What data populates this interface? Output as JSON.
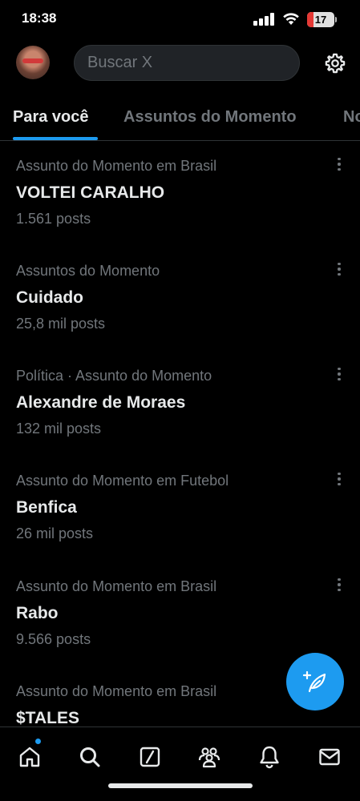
{
  "status_bar": {
    "time": "18:38",
    "battery": "17"
  },
  "header": {
    "search_placeholder": "Buscar X"
  },
  "tabs": [
    {
      "label": "Para você",
      "active": true
    },
    {
      "label": "Assuntos do Momento",
      "active": false
    },
    {
      "label": "No",
      "active": false
    }
  ],
  "trends": [
    {
      "context": "Assunto do Momento em Brasil",
      "name": "VOLTEI CARALHO",
      "count": "1.561 posts"
    },
    {
      "context": "Assuntos do Momento",
      "name": "Cuidado",
      "count": "25,8 mil posts"
    },
    {
      "context": "Política · Assunto do Momento",
      "name": "Alexandre de Moraes",
      "count": "132 mil posts"
    },
    {
      "context": "Assunto do Momento em Futebol",
      "name": "Benfica",
      "count": "26 mil posts"
    },
    {
      "context": "Assunto do Momento em Brasil",
      "name": "Rabo",
      "count": "9.566 posts"
    },
    {
      "context": "Assunto do Momento em Brasil",
      "name": "$TALES",
      "count": ""
    }
  ],
  "colors": {
    "accent": "#1d9bf0",
    "background": "#000000",
    "secondary_text": "#71767b",
    "battery_low": "#e53935"
  },
  "icons": {
    "bottom_nav": [
      "home-icon",
      "search-icon",
      "grok-icon",
      "communities-icon",
      "notifications-icon",
      "messages-icon"
    ],
    "fab": "compose-post-icon"
  }
}
